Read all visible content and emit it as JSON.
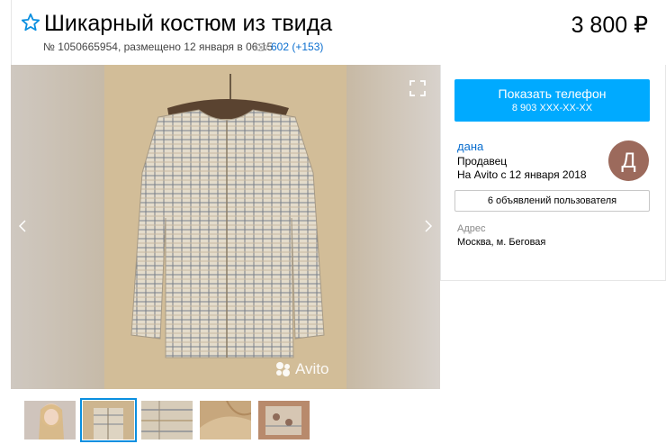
{
  "header": {
    "title": "Шикарный костюм из твида",
    "price": "3 800 ₽",
    "meta": "№ 1050665954, размещено 12 января в 06:15",
    "views": "602 (+153)"
  },
  "gallery": {
    "watermark": "Avito",
    "thumbnails": [
      {
        "name": "thumb-1",
        "active": false
      },
      {
        "name": "thumb-2",
        "active": true
      },
      {
        "name": "thumb-3",
        "active": false
      },
      {
        "name": "thumb-4",
        "active": false
      },
      {
        "name": "thumb-5",
        "active": false
      }
    ]
  },
  "contact": {
    "button_label": "Показать телефон",
    "phone_masked": "8 903 XXX-XX-XX"
  },
  "seller": {
    "name": "дана",
    "role": "Продавец",
    "since": "На Avito с 12 января 2018",
    "avatar_letter": "Д",
    "ads_link": "6 объявлений пользователя"
  },
  "address": {
    "label": "Адрес",
    "value": "Москва, м. Беговая"
  },
  "colors": {
    "accent_blue": "#00aaff",
    "link_blue": "#0a6ecf",
    "avatar_bg": "#9c6a5c"
  },
  "icons": [
    "star-icon",
    "eye-icon",
    "expand-icon",
    "chevron-left-icon",
    "chevron-right-icon",
    "avito-logo-icon"
  ]
}
